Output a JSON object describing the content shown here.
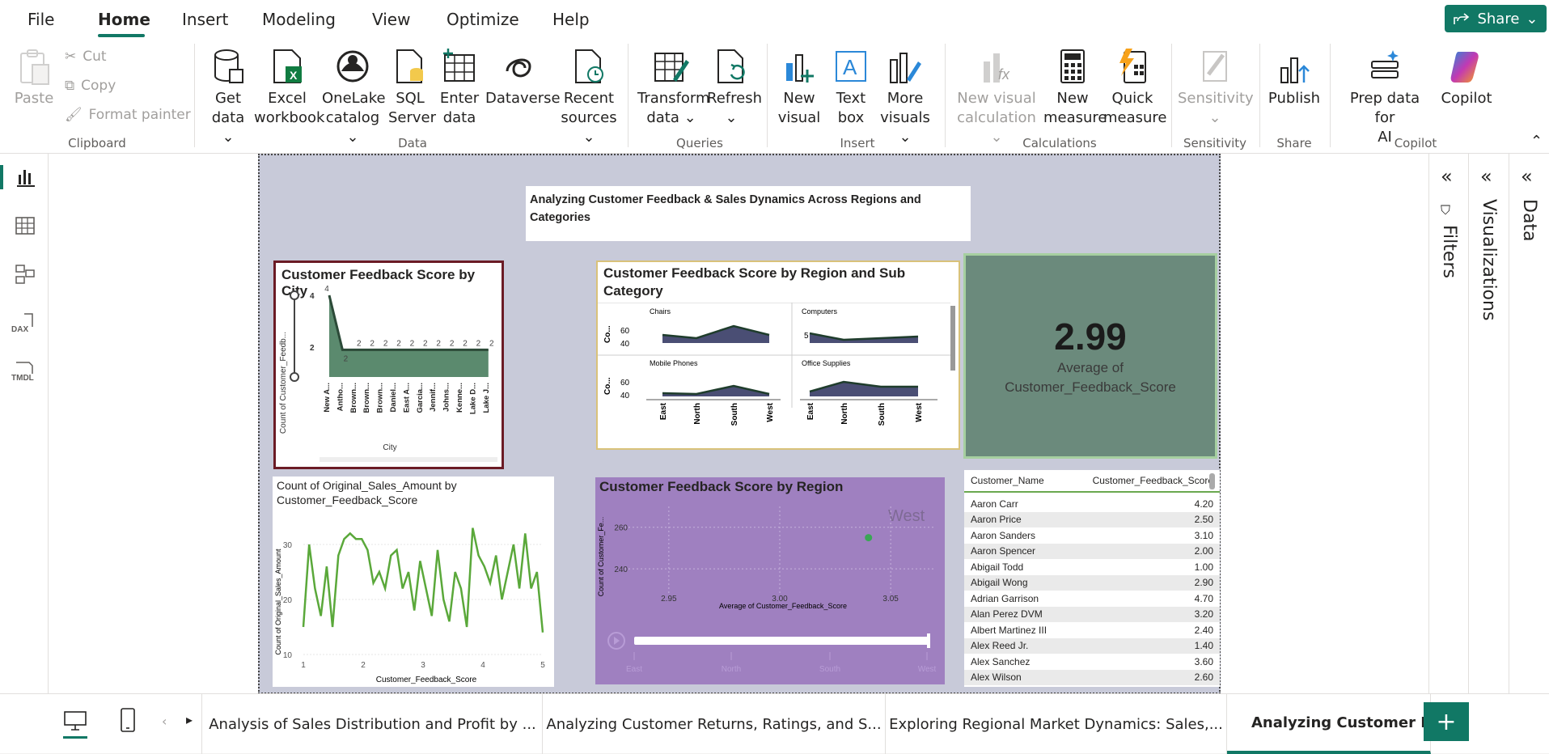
{
  "menu": {
    "items": [
      "File",
      "Home",
      "Insert",
      "Modeling",
      "View",
      "Optimize",
      "Help"
    ],
    "share_label": "Share"
  },
  "ribbon": {
    "clipboard": {
      "paste": "Paste",
      "cut": "Cut",
      "copy": "Copy",
      "format_painter": "Format painter",
      "label": "Clipboard"
    },
    "data": {
      "get_data": [
        "Get",
        "data"
      ],
      "excel": [
        "Excel",
        "workbook"
      ],
      "onelake": [
        "OneLake",
        "catalog"
      ],
      "sql": [
        "SQL",
        "Server"
      ],
      "enter": [
        "Enter",
        "data"
      ],
      "dataverse": "Dataverse",
      "recent": [
        "Recent",
        "sources"
      ],
      "label": "Data"
    },
    "queries": {
      "transform": [
        "Transform",
        "data"
      ],
      "refresh": "Refresh",
      "label": "Queries"
    },
    "insert": {
      "new_visual": [
        "New",
        "visual"
      ],
      "text_box": [
        "Text",
        "box"
      ],
      "more": [
        "More",
        "visuals"
      ],
      "label": "Insert"
    },
    "calculations": {
      "new_visual_calc": [
        "New visual",
        "calculation"
      ],
      "new_measure": [
        "New",
        "measure"
      ],
      "quick_measure": [
        "Quick",
        "measure"
      ],
      "label": "Calculations"
    },
    "sensitivity": {
      "btn": "Sensitivity",
      "label": "Sensitivity"
    },
    "share": {
      "publish": "Publish",
      "label": "Share"
    },
    "copilot": {
      "prep": [
        "Prep data for",
        "AI"
      ],
      "copilot": "Copilot",
      "label": "Copilot"
    }
  },
  "report": {
    "title": "Analyzing Customer Feedback & Sales Dynamics Across Regions and Categories",
    "city_chart": {
      "title": "Customer Feedback Score by City",
      "ylabel": "Count of Customer_Feedb...",
      "xlabel": "City",
      "ticks": [
        "4",
        "2"
      ],
      "categories": [
        "New A...",
        "Antho...",
        "Brown...",
        "Brown...",
        "Brown...",
        "Daniel...",
        "East A...",
        "Garcia...",
        "Jennif...",
        "Johns...",
        "Kenne...",
        "Lake D...",
        "Lake J..."
      ],
      "labels": [
        "4",
        "2",
        "2",
        "2",
        "2",
        "2",
        "2",
        "2",
        "2",
        "2",
        "2",
        "2",
        "2"
      ]
    },
    "region_sub_chart": {
      "title": "Customer Feedback Score by Region and Sub Category",
      "panels": [
        "Chairs",
        "Computers",
        "Mobile Phones",
        "Office Supplies"
      ],
      "ylabel": "Co...",
      "ticks": [
        "60",
        "40"
      ],
      "x_categories": [
        "East",
        "North",
        "South",
        "West"
      ]
    },
    "kpi": {
      "value": "2.99",
      "label": "Average of Customer_Feedback_Score"
    },
    "sales_chart": {
      "title": "Count of Original_Sales_Amount by Customer_Feedback_Score",
      "ylabel": "Count of Original_Sales_Amount",
      "xlabel": "Customer_Feedback_Score",
      "yticks": [
        "30",
        "20",
        "10"
      ],
      "xticks": [
        "1",
        "2",
        "3",
        "4",
        "5"
      ]
    },
    "region_scatter": {
      "title": "Customer Feedback Score by Region",
      "ylabel": "Count of Customer_Fe...",
      "xlabel": "Average of Customer_Feedback_Score",
      "yticks": [
        "260",
        "240"
      ],
      "xticks": [
        "2.95",
        "3.00",
        "3.05"
      ],
      "play_label": "West",
      "slider_labels": [
        "East",
        "North",
        "South",
        "West"
      ]
    },
    "table": {
      "headers": [
        "Customer_Name",
        "Customer_Feedback_Score"
      ],
      "rows": [
        [
          "Aaron Carr",
          "4.20"
        ],
        [
          "Aaron Price",
          "2.50"
        ],
        [
          "Aaron Sanders",
          "3.10"
        ],
        [
          "Aaron Spencer",
          "2.00"
        ],
        [
          "Abigail Todd",
          "1.00"
        ],
        [
          "Abigail Wong",
          "2.90"
        ],
        [
          "Adrian Garrison",
          "4.70"
        ],
        [
          "Alan Perez DVM",
          "3.20"
        ],
        [
          "Albert Martinez III",
          "2.40"
        ],
        [
          "Alex Reed Jr.",
          "1.40"
        ],
        [
          "Alex Sanchez",
          "3.60"
        ],
        [
          "Alex Wilson",
          "2.60"
        ]
      ]
    }
  },
  "panes": {
    "filters": "Filters",
    "visualizations": "Visualizations",
    "data": "Data"
  },
  "pages": [
    "Analysis of Sales Distribution and Profit by ...",
    "Analyzing Customer Returns, Ratings, and S...",
    "Exploring Regional Market Dynamics: Sales,...",
    "Analyzing Customer Feedb..."
  ],
  "chart_data": [
    {
      "type": "area",
      "title": "Customer Feedback Score by City",
      "xlabel": "City",
      "ylabel": "Count of Customer_Feedb...",
      "categories": [
        "New A...",
        "Antho...",
        "Brown...",
        "Brown...",
        "Brown...",
        "Daniel...",
        "East A...",
        "Garcia...",
        "Jennif...",
        "Johns...",
        "Kenne...",
        "Lake D...",
        "Lake J..."
      ],
      "values": [
        4,
        2,
        2,
        2,
        2,
        2,
        2,
        2,
        2,
        2,
        2,
        2,
        2
      ],
      "ylim": [
        1,
        4
      ]
    },
    {
      "type": "line",
      "title": "Count of Original_Sales_Amount by Customer_Feedback_Score",
      "xlabel": "Customer_Feedback_Score",
      "ylabel": "Count of Original_Sales_Amount",
      "x": [
        1.0,
        1.1,
        1.2,
        1.3,
        1.4,
        1.5,
        1.6,
        1.7,
        1.8,
        1.9,
        2.0,
        2.1,
        2.2,
        2.3,
        2.4,
        2.5,
        2.6,
        2.7,
        2.8,
        2.9,
        3.0,
        3.1,
        3.2,
        3.3,
        3.4,
        3.5,
        3.6,
        3.7,
        3.8,
        3.9,
        4.0,
        4.1,
        4.2,
        4.3,
        4.4,
        4.5,
        4.6,
        4.7,
        4.8,
        4.9,
        5.0
      ],
      "values": [
        15,
        30,
        22,
        17,
        26,
        15,
        28,
        31,
        32,
        31,
        31,
        29,
        23,
        25,
        22,
        28,
        29,
        22,
        25,
        18,
        27,
        22,
        17,
        29,
        20,
        16,
        25,
        22,
        15,
        33,
        28,
        26,
        23,
        28,
        20,
        25,
        30,
        22,
        32,
        22,
        25,
        14
      ],
      "ylim": [
        10,
        35
      ],
      "xlim": [
        1,
        5
      ]
    },
    {
      "type": "scatter",
      "title": "Customer Feedback Score by Region",
      "xlabel": "Average of Customer_Feedback_Score",
      "ylabel": "Count of Customer_Fe...",
      "series": [
        {
          "name": "West",
          "x": [
            3.04
          ],
          "y": [
            255
          ]
        }
      ],
      "xlim": [
        2.93,
        3.07
      ],
      "ylim": [
        228,
        270
      ]
    }
  ]
}
